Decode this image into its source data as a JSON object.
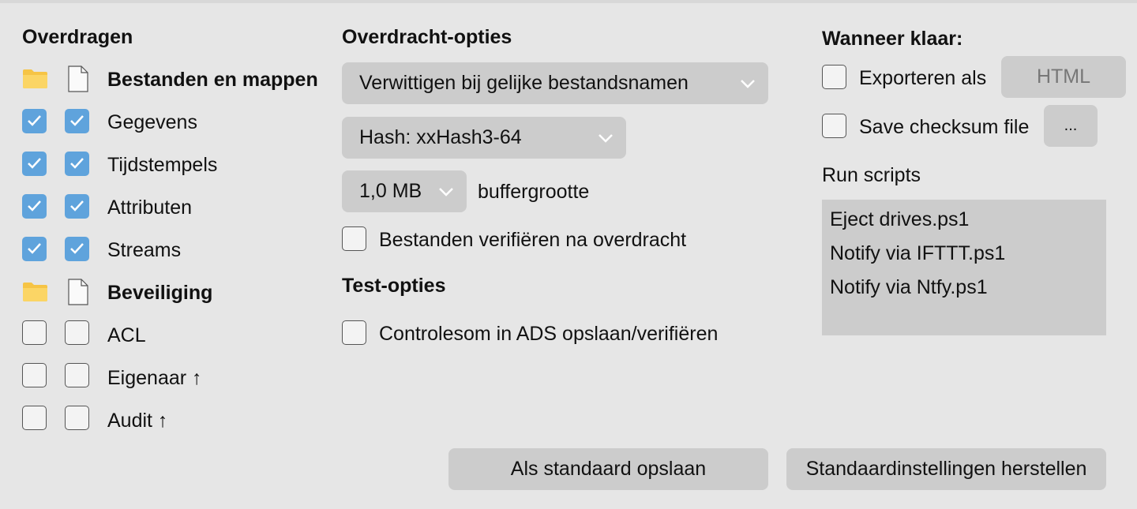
{
  "transfer": {
    "heading": "Overdragen",
    "rows": [
      {
        "label": "Bestanden en mappen",
        "bold": true,
        "type": "section"
      },
      {
        "label": "Gegevens",
        "folder_checked": true,
        "file_checked": true
      },
      {
        "label": "Tijdstempels",
        "folder_checked": true,
        "file_checked": true
      },
      {
        "label": "Attributen",
        "folder_checked": true,
        "file_checked": true
      },
      {
        "label": "Streams",
        "folder_checked": true,
        "file_checked": true
      },
      {
        "label": "Beveiliging",
        "bold": true,
        "type": "section"
      },
      {
        "label": "ACL",
        "folder_checked": false,
        "file_checked": false
      },
      {
        "label": "Eigenaar ↑",
        "folder_checked": false,
        "file_checked": false
      },
      {
        "label": "Audit ↑",
        "folder_checked": false,
        "file_checked": false
      }
    ]
  },
  "options": {
    "heading": "Overdracht-opties",
    "conflict_select": "Verwittigen bij gelijke bestandsnamen",
    "hash_select": "Hash: xxHash3-64",
    "buffer_select": "1,0 MB",
    "buffer_label": "buffergrootte",
    "verify_label": "Bestanden verifiëren na overdracht",
    "verify_checked": false
  },
  "test": {
    "heading": "Test-opties",
    "ads_label": "Controlesom in ADS opslaan/verifiëren",
    "ads_checked": false
  },
  "when_done": {
    "heading": "Wanneer klaar:",
    "export_label": "Exporteren als",
    "export_checked": false,
    "export_format_button": "HTML",
    "checksum_label": "Save checksum file",
    "checksum_checked": false,
    "checksum_browse_button": "...",
    "scripts_label": "Run scripts",
    "scripts": [
      "Eject drives.ps1",
      "Notify via IFTTT.ps1",
      "Notify via Ntfy.ps1"
    ]
  },
  "footer": {
    "save_default_button": "Als standaard opslaan",
    "restore_defaults_button": "Standaardinstellingen herstellen"
  },
  "colors": {
    "background": "#e6e6e6",
    "control": "#cccccc",
    "checkbox_checked": "#5fa3dc",
    "folder_icon": "#f6c445"
  }
}
